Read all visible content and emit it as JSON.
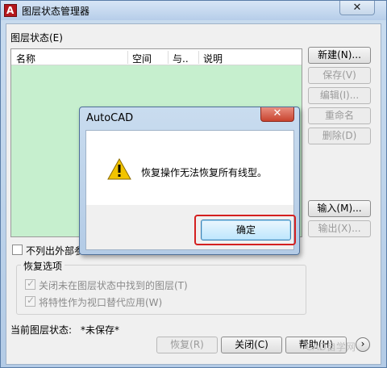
{
  "window": {
    "title": "图层状态管理器",
    "close_glyph": "✕"
  },
  "layer_states": {
    "section_label": "图层状态(E)",
    "columns": [
      "名称",
      "空间",
      "与..",
      "说明"
    ]
  },
  "side_buttons": {
    "new": "新建(N)...",
    "save": "保存(V)",
    "edit": "编辑(I)...",
    "rename": "重命名",
    "delete": "删除(D)",
    "import": "输入(M)...",
    "export": "输出(X)..."
  },
  "options": {
    "xref_checkbox_label": "不列出外部参",
    "restore_group_title": "恢复选项",
    "restore_off_layers": "关闭未在图层状态中找到的图层(T)",
    "apply_as_viewport_override": "将特性作为视口替代应用(W)"
  },
  "status": {
    "current_label": "当前图层状态:",
    "current_value": "*未保存*"
  },
  "bottom_buttons": {
    "restore": "恢复(R)",
    "close": "关闭(C)",
    "help": "帮助(H)",
    "more_glyph": "›"
  },
  "dialog": {
    "title": "AutoCAD",
    "close_glyph": "✕",
    "message": "恢复操作无法恢复所有线型。",
    "ok_label": "确定"
  },
  "watermark": "CAD自学网",
  "colors": {
    "list_background": "#c6efce",
    "highlight_frame": "#d42020",
    "warning_fill": "#f2c400"
  }
}
